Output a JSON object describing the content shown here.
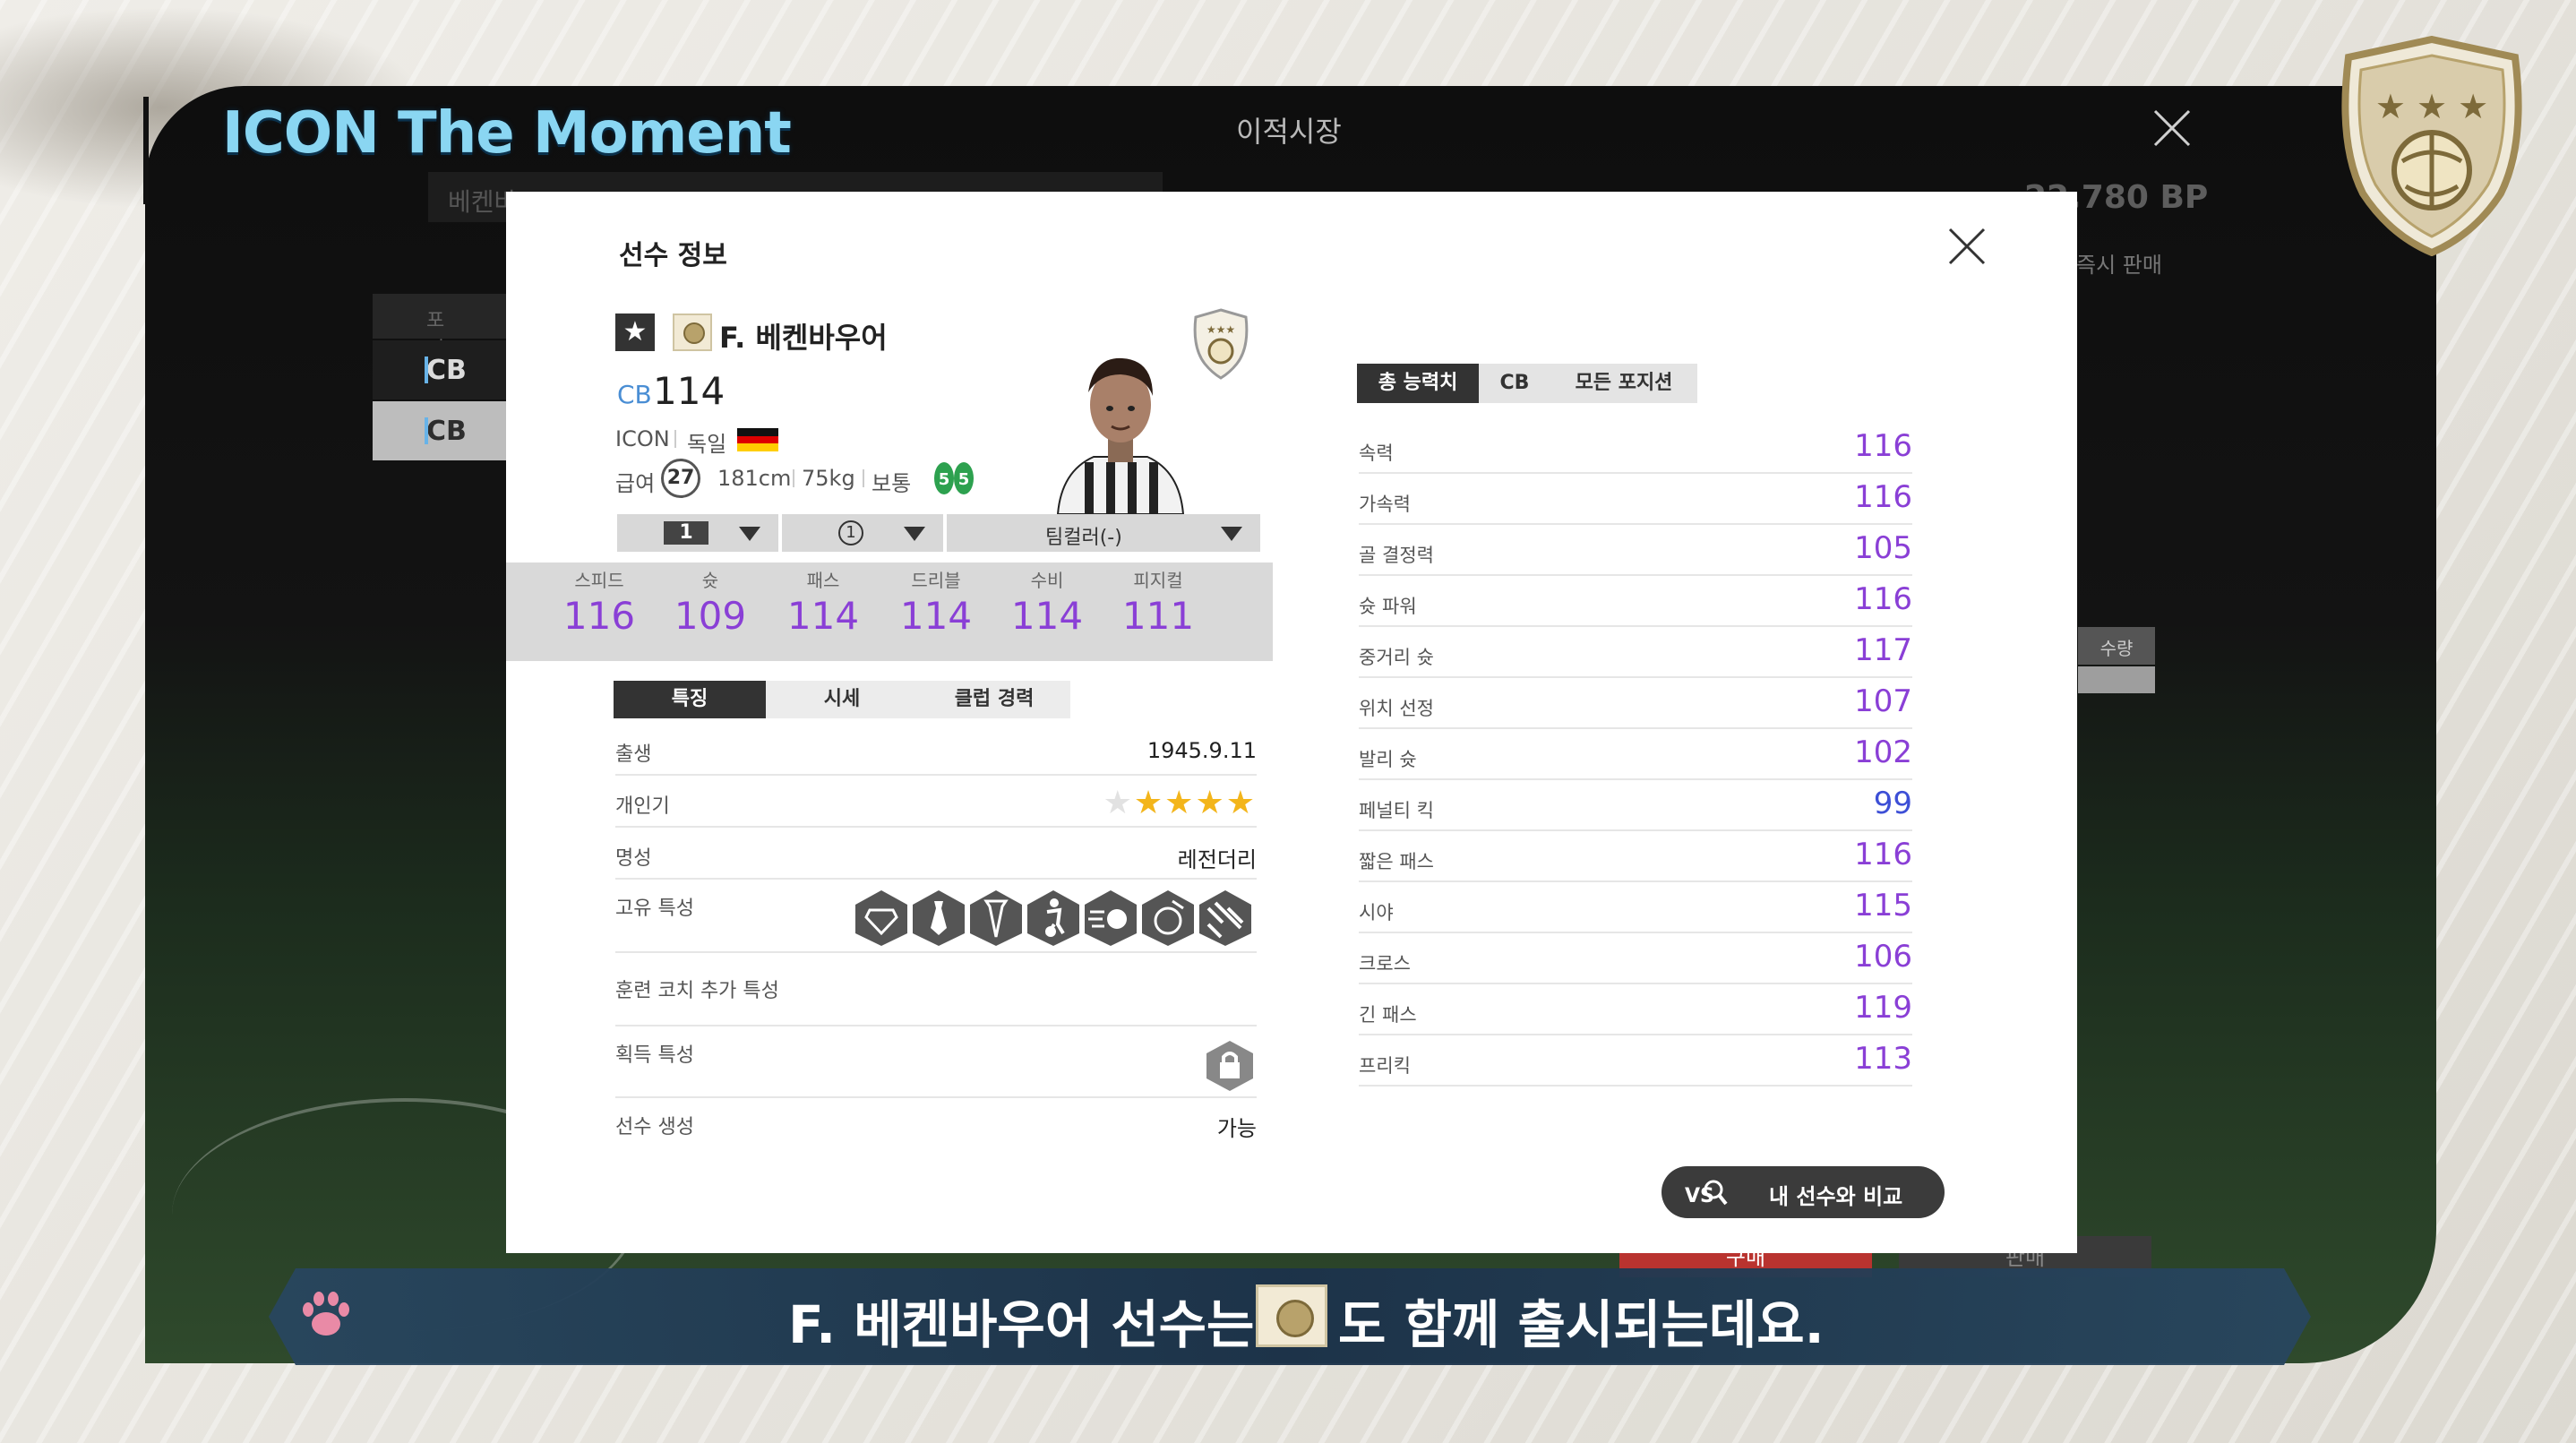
{
  "overlay": {
    "title": "ICON The Moment"
  },
  "market": {
    "title": "이적시장",
    "bp": "22,780 BP",
    "quick_sell": "즉시 판매",
    "search_text": "베켄바",
    "pos_header": "포지션",
    "pos_items": [
      "CB",
      "CB"
    ],
    "qty_header": "수량",
    "buy": "구매",
    "sell": "판매"
  },
  "modal": {
    "title": "선수 정보",
    "player": {
      "name": "F. 베켄바우어",
      "position": "CB",
      "ovr": "114",
      "card_type": "ICON",
      "nation": "독일",
      "salary_label": "급여",
      "salary": "27",
      "height": "181cm",
      "weight": "75kg",
      "body_type": "보통",
      "left_foot": "5",
      "right_foot": "5"
    },
    "dropdowns": {
      "level": "1",
      "enhance": "1",
      "team_color": "팀컬러(-)"
    },
    "stats": [
      {
        "label": "스피드",
        "value": "116"
      },
      {
        "label": "슛",
        "value": "109"
      },
      {
        "label": "패스",
        "value": "114"
      },
      {
        "label": "드리블",
        "value": "114"
      },
      {
        "label": "수비",
        "value": "114"
      },
      {
        "label": "피지컬",
        "value": "111"
      }
    ],
    "tabs": [
      "특징",
      "시세",
      "클럽 경력"
    ],
    "info": {
      "birth_label": "출생",
      "birth": "1945.9.11",
      "skill_label": "개인기",
      "skill_stars": 4,
      "rep_label": "명성",
      "rep": "레전더리",
      "traits_label": "고유 특성",
      "coach_label": "훈련 코치 추가 특성",
      "acquired_label": "획득 특성",
      "create_label": "선수 생성",
      "create": "가능"
    },
    "trait_icons": [
      "diamond-trait-icon",
      "tie-trait-icon",
      "tie-alt-trait-icon",
      "player-trait-icon",
      "speed-ball-trait-icon",
      "ball-trait-icon",
      "pattern-trait-icon"
    ],
    "right_tabs": [
      "총 능력치",
      "CB",
      "모든 포지션"
    ],
    "attributes": [
      {
        "label": "속력",
        "value": "116"
      },
      {
        "label": "가속력",
        "value": "116"
      },
      {
        "label": "골 결정력",
        "value": "105"
      },
      {
        "label": "슛 파워",
        "value": "116"
      },
      {
        "label": "중거리 슛",
        "value": "117"
      },
      {
        "label": "위치 선정",
        "value": "107"
      },
      {
        "label": "발리 슛",
        "value": "102"
      },
      {
        "label": "페널티 킥",
        "value": "99"
      },
      {
        "label": "짧은 패스",
        "value": "116"
      },
      {
        "label": "시야",
        "value": "115"
      },
      {
        "label": "크로스",
        "value": "106"
      },
      {
        "label": "긴 패스",
        "value": "119"
      },
      {
        "label": "프리킥",
        "value": "113"
      }
    ],
    "compare_label": "내 선수와 비교"
  },
  "subtitle": {
    "before": "F. 베켄바우어 선수는",
    "after": "도 함께 출시되는데요."
  },
  "colors": {
    "stat_purple": "#8a3fd6",
    "stat_blue": "#3d4fd6",
    "title_cyan": "#8ad6f2",
    "star_gold": "#f3b51b"
  }
}
